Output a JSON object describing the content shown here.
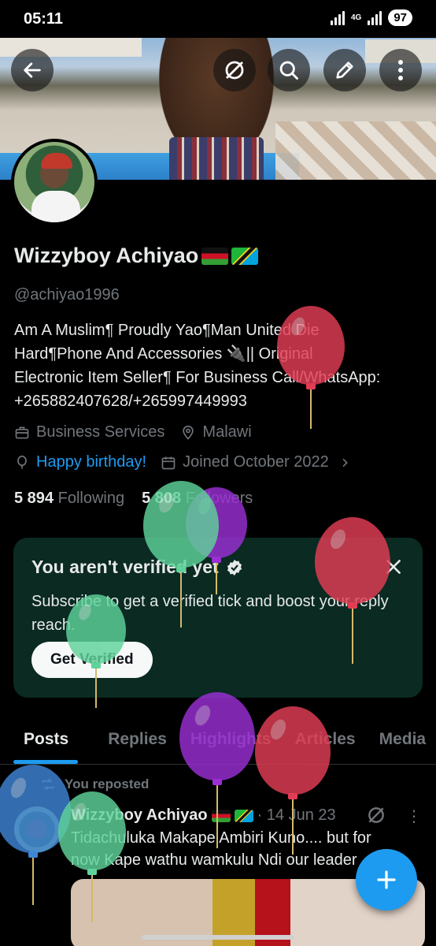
{
  "status_bar": {
    "time": "05:11",
    "network": "4G",
    "battery": "97"
  },
  "header": {
    "back_icon": "arrow-left-icon",
    "grok_icon": "slash-circle-icon",
    "search_icon": "search-icon",
    "edit_icon": "pencil-icon",
    "more_icon": "vertical-dots-icon"
  },
  "profile": {
    "display_name": "Wizzyboy Achiyao",
    "handle": "@achiyao1996",
    "bio_lines": [
      "Am A Muslim¶ Proudly Yao¶Man United Die",
      "Hard¶Phone And Accessories 🔌|| Original",
      "Electronic Item Seller¶ For Business Call/WhatsApp:",
      "+265882407628/+265997449993"
    ],
    "category": "Business Services",
    "location": "Malawi",
    "birthday": "Happy birthday!",
    "joined": "Joined October 2022",
    "following_count": "5 894",
    "following_label": "Following",
    "followers_count": "5 808",
    "followers_label": "Followers"
  },
  "verify_card": {
    "title": "You aren't verified yet",
    "text": "Subscribe to get a verified tick and boost your reply reach.",
    "button": "Get Verified"
  },
  "tabs": [
    "Posts",
    "Replies",
    "Highlights",
    "Articles",
    "Media"
  ],
  "post": {
    "repost_label": "You reposted",
    "author": "Wizzyboy Achiyao",
    "date": "· 14 Jun 23",
    "more": "⋮",
    "text_lines": [
      "Tidachuluka Makape Ambiri Kuno.... but for",
      "now Kape wathu wamkulu Ndi our leader"
    ]
  },
  "fab": {
    "label": "+"
  },
  "colors": {
    "accent": "#1d9bf0",
    "muted": "#71767b",
    "text": "#e7e9ea",
    "card": "#0a2a22",
    "background": "#000000"
  }
}
